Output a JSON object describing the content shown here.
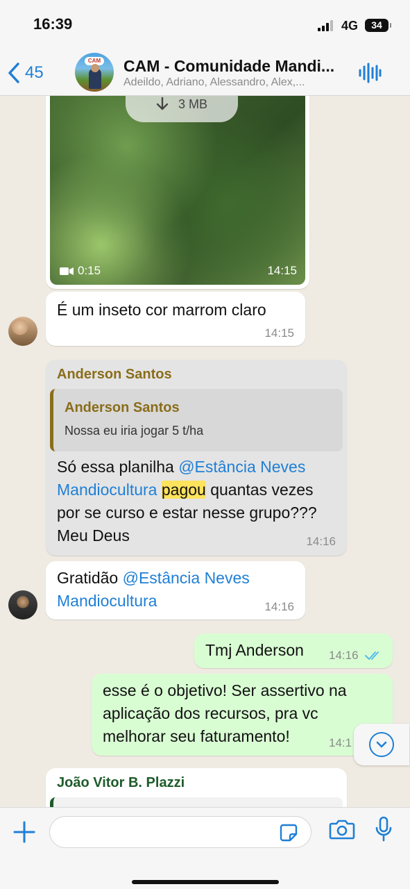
{
  "status": {
    "time": "16:39",
    "network": "4G",
    "battery": "34"
  },
  "header": {
    "back_count": "45",
    "title": "CAM - Comunidade Mandi...",
    "members": "Adeildo, Adriano, Alessandro, Alex,...",
    "avatar_logo_text": "CAM"
  },
  "messages": {
    "video": {
      "size": "3 MB",
      "duration": "0:15",
      "time": "14:15"
    },
    "insect": {
      "text": "É um inseto cor marrom claro",
      "time": "14:15"
    },
    "anderson": {
      "sender": "Anderson Santos",
      "quote_sender": "Anderson Santos",
      "quote_text": "Nossa eu iria jogar 5 t/ha",
      "text_part1": "Só essa planilha ",
      "mention": "@Estância Neves Mandiocultura",
      "highlight": "pagou",
      "text_part2": " quantas vezes por se curso e estar nesse grupo??? Meu Deus",
      "time": "14:16"
    },
    "gratidao": {
      "text": "Gratidão ",
      "mention": "@Estância Neves Mandiocultura",
      "time": "14:16"
    },
    "tmj": {
      "text": "Tmj Anderson",
      "time": "14:16"
    },
    "objetivo": {
      "text": "esse é o objetivo! Ser assertivo na aplicação dos recursos, pra vc melhorar seu faturamento!",
      "time_partial": "14:1"
    },
    "joao": {
      "sender": "João Vitor B. Plazzi"
    }
  },
  "colors": {
    "accent": "#1f7fd6",
    "outgoing_bubble": "#d9fdd3",
    "anderson_name": "#8a6d1a",
    "joao_name": "#1e5b2a",
    "highlight": "#ffe35c"
  },
  "icons": [
    "chevron-left-icon",
    "audio-wave-icon",
    "download-icon",
    "video-camera-icon",
    "double-check-icon",
    "chevron-down-icon",
    "plus-icon",
    "sticker-icon",
    "camera-icon",
    "microphone-icon"
  ]
}
